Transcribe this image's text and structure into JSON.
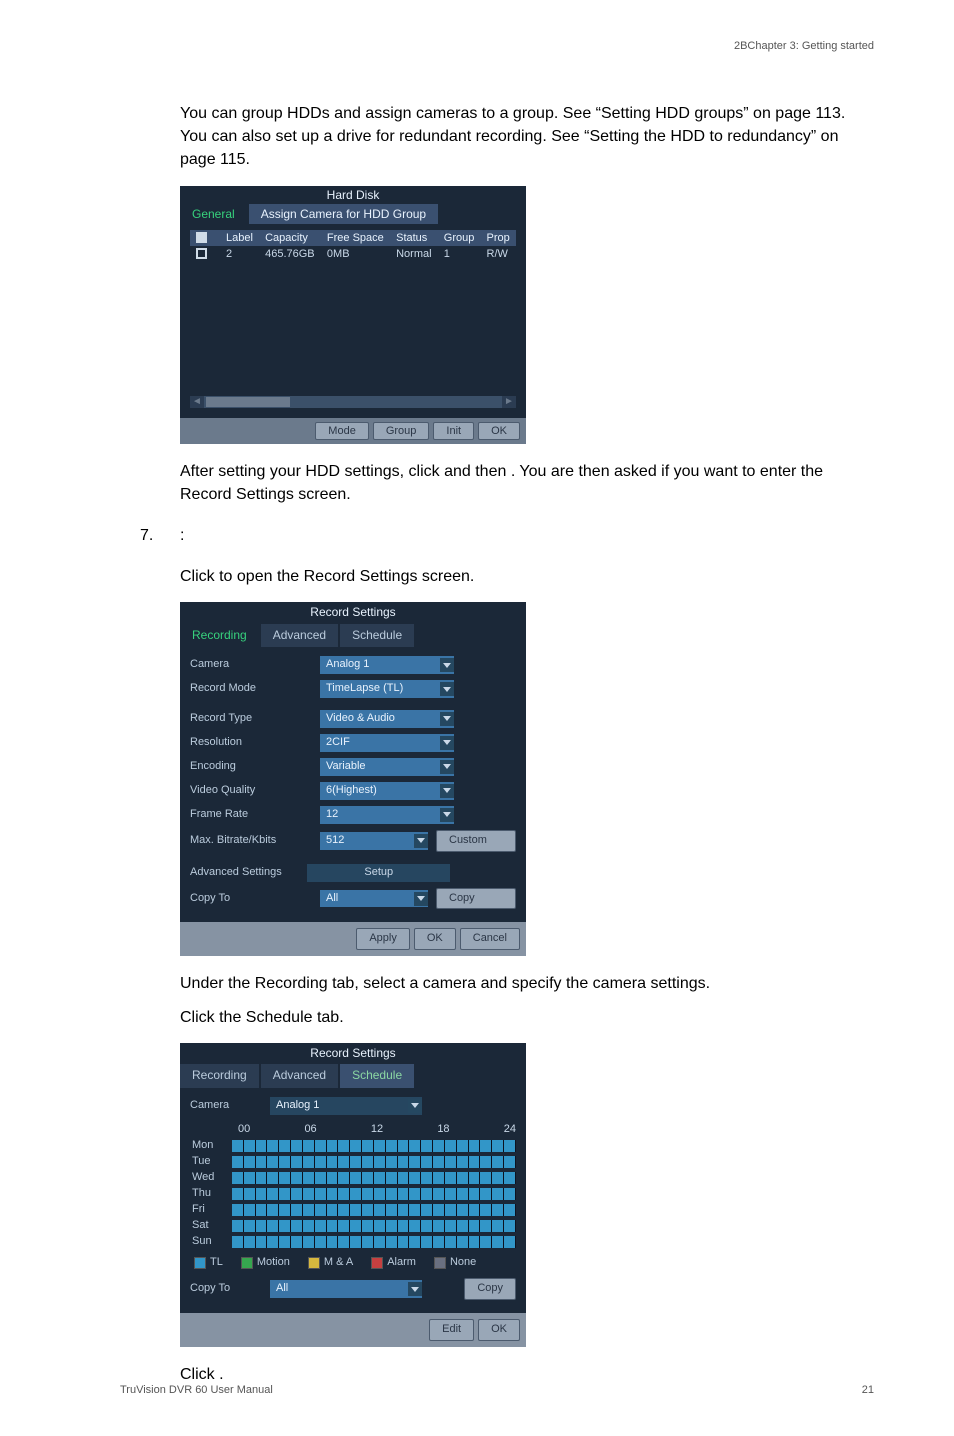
{
  "header": {
    "chapter": "2BChapter 3: Getting started"
  },
  "paras": {
    "p1": "You can group HDDs and assign cameras to a group. See “Setting HDD groups” on page 113. You can also set up a drive for redundant recording. See “Setting the HDD to redundancy” on page 115.",
    "p2a": "After setting your HDD settings, click ",
    "p2b": " and then ",
    "p2c": ". You are then asked if you want to enter the Record Settings screen.",
    "step_num": "7.",
    "step_colon": ":",
    "p3a": "Click ",
    "p3b": " to open the Record Settings screen.",
    "p4": "Under the Recording tab, select a camera and specify the camera settings.",
    "p5": "Click the Schedule tab.",
    "p6a": "Click ",
    "p6b": "."
  },
  "shot1": {
    "title": "Hard Disk",
    "tab_general": "General",
    "tab_assign": "Assign Camera for HDD Group",
    "cols": {
      "label": "Label",
      "capacity": "Capacity",
      "free": "Free Space",
      "status": "Status",
      "group": "Group",
      "prop": "Prop"
    },
    "row": {
      "label": "2",
      "capacity": "465.76GB",
      "free": "0MB",
      "status": "Normal",
      "group": "1",
      "prop": "R/W"
    },
    "btn_mode": "Mode",
    "btn_group": "Group",
    "btn_init": "Init",
    "btn_ok": "OK"
  },
  "shot2": {
    "title": "Record Settings",
    "tab_rec": "Recording",
    "tab_adv": "Advanced",
    "tab_sched": "Schedule",
    "rows": {
      "camera": {
        "l": "Camera",
        "v": "Analog 1"
      },
      "mode": {
        "l": "Record Mode",
        "v": "TimeLapse (TL)"
      },
      "type": {
        "l": "Record Type",
        "v": "Video & Audio"
      },
      "res": {
        "l": "Resolution",
        "v": "2CIF"
      },
      "enc": {
        "l": "Encoding",
        "v": "Variable"
      },
      "qual": {
        "l": "Video Quality",
        "v": "6(Highest)"
      },
      "rate": {
        "l": "Frame Rate",
        "v": "12"
      },
      "bit": {
        "l": "Max. Bitrate/Kbits",
        "v": "512"
      },
      "adv": {
        "l": "Advanced Settings"
      },
      "copy": {
        "l": "Copy To",
        "v": "All"
      }
    },
    "btn_custom": "Custom",
    "btn_setup": "Setup",
    "btn_copy": "Copy",
    "btn_apply": "Apply",
    "btn_ok": "OK",
    "btn_cancel": "Cancel"
  },
  "shot3": {
    "title": "Record Settings",
    "tab_rec": "Recording",
    "tab_adv": "Advanced",
    "tab_sched": "Schedule",
    "camera_label": "Camera",
    "camera_val": "Analog 1",
    "cols": {
      "c00": "00",
      "c06": "06",
      "c12": "12",
      "c18": "18",
      "c24": "24"
    },
    "days": {
      "mon": "Mon",
      "tue": "Tue",
      "wed": "Wed",
      "thu": "Thu",
      "fri": "Fri",
      "sat": "Sat",
      "sun": "Sun"
    },
    "legend": {
      "tl": "TL",
      "motion": "Motion",
      "ma": "M & A",
      "alarm": "Alarm",
      "none": "None"
    },
    "copy_label": "Copy To",
    "copy_val": "All",
    "btn_copy": "Copy",
    "btn_edit": "Edit",
    "btn_ok": "OK"
  },
  "footer": {
    "left": "TruVision DVR 60 User Manual",
    "right": "21"
  }
}
